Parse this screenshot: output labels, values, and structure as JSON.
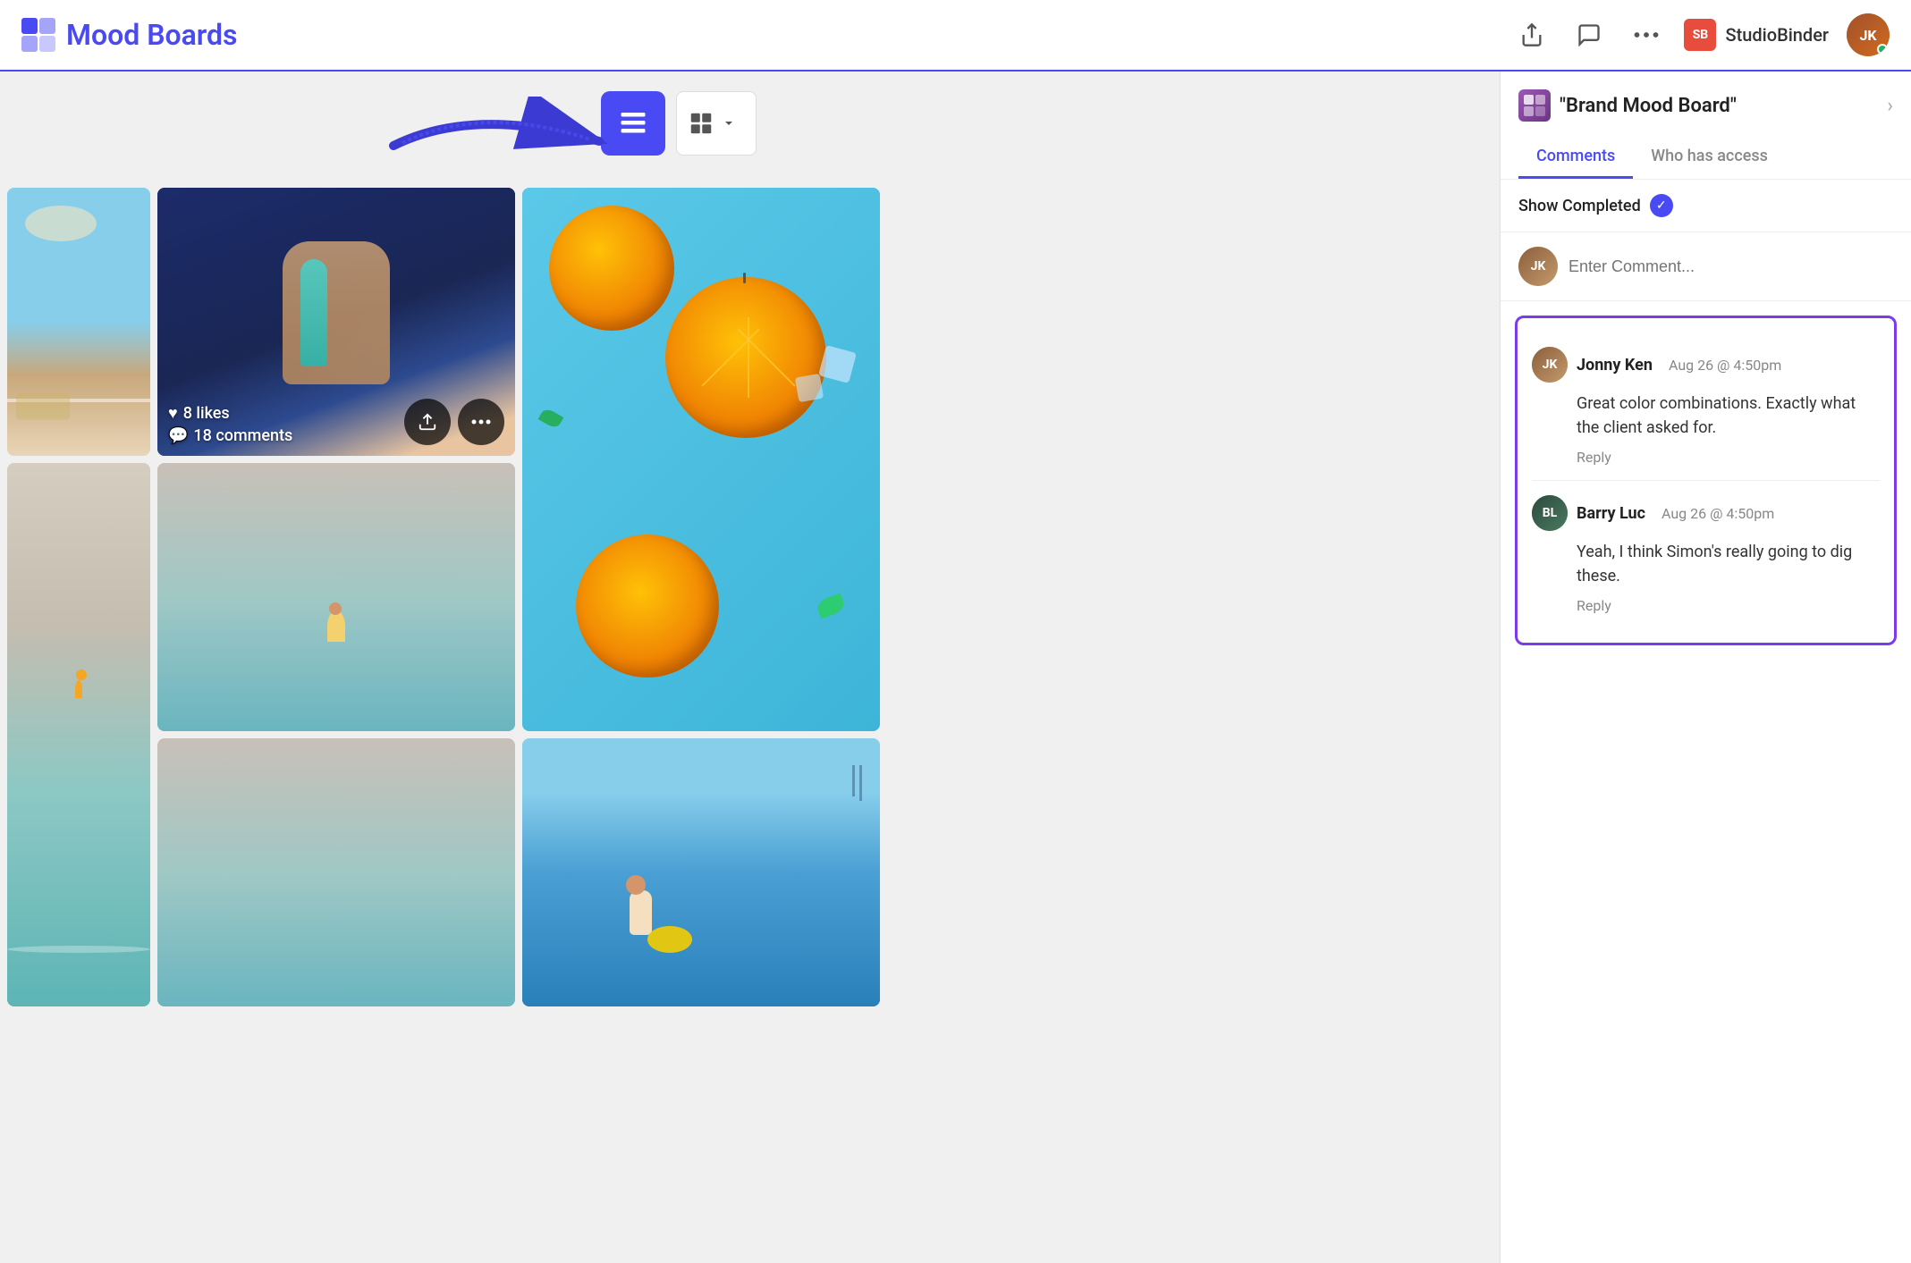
{
  "header": {
    "title": "Mood Boards",
    "logo_alt": "StudioBinder logo",
    "brand_name": "StudioBinder",
    "actions": {
      "share_icon": "share",
      "comment_icon": "comment",
      "more_icon": "more"
    }
  },
  "view_toggle": {
    "list_view_label": "List view",
    "grid_view_label": "Grid view"
  },
  "right_panel": {
    "title": "\"Brand Mood Board\"",
    "tabs": [
      {
        "label": "Comments",
        "active": true
      },
      {
        "label": "Who has access",
        "active": false
      }
    ],
    "show_completed_label": "Show Completed",
    "comment_placeholder": "Enter Comment...",
    "comments": [
      {
        "author": "Jonny Ken",
        "time": "Aug 26 @ 4:50pm",
        "text": "Great color combinations. Exactly what the client asked for.",
        "reply_label": "Reply"
      },
      {
        "author": "Barry Luc",
        "time": "Aug 26 @ 4:50pm",
        "text": "Yeah, I think Simon's really going to dig these.",
        "reply_label": "Reply"
      }
    ]
  },
  "image_grid": {
    "image1_likes": "8 likes",
    "image1_comments": "18 comments"
  },
  "colors": {
    "accent": "#4a4af4",
    "highlight_border": "#7c3aed"
  }
}
